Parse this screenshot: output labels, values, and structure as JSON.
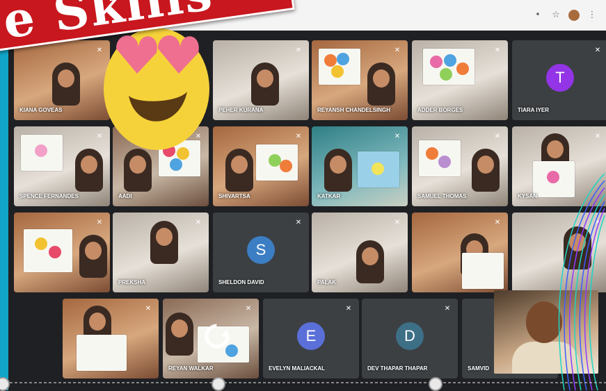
{
  "banner": {
    "text": "e Skills"
  },
  "browser": {
    "icons": [
      "more-icon",
      "star-icon",
      "profile-avatar",
      "menu-icon"
    ]
  },
  "participants": [
    {
      "name": "KIANA GOVEAS",
      "kind": "camera"
    },
    {
      "name": "PEHER KURANA",
      "kind": "camera"
    },
    {
      "name": "REYANSH CHANDELSINGH",
      "kind": "camera"
    },
    {
      "name": "ADDER BORGES",
      "kind": "camera"
    },
    {
      "name": "TIARA IYER",
      "kind": "avatar",
      "initial": "T",
      "color": "#9334e6"
    },
    {
      "name": "SPENCE FERNANDES",
      "kind": "camera"
    },
    {
      "name": "AADI",
      "kind": "camera"
    },
    {
      "name": "SHIVARTSA",
      "kind": "camera"
    },
    {
      "name": "KATKAR",
      "kind": "camera"
    },
    {
      "name": "SAMUEL THOMAS",
      "kind": "camera"
    },
    {
      "name": "KYSAN",
      "kind": "camera"
    },
    {
      "name": "",
      "kind": "camera"
    },
    {
      "name": "PREKSHA",
      "kind": "camera"
    },
    {
      "name": "SHELDON DAVID",
      "kind": "avatar",
      "initial": "S",
      "color": "#3c7ec4"
    },
    {
      "name": "PALAK",
      "kind": "camera"
    },
    {
      "name": "",
      "kind": "camera"
    },
    {
      "name": "",
      "kind": "camera"
    },
    {
      "name": "",
      "kind": "camera"
    },
    {
      "name": "REYAN WALKAR",
      "kind": "camera"
    },
    {
      "name": "EVELYN MALIACKAL",
      "kind": "avatar",
      "initial": "E",
      "color": "#5a6fd8"
    },
    {
      "name": "DEV THAPAR THAPAR",
      "kind": "avatar",
      "initial": "D",
      "color": "#3d6f86"
    },
    {
      "name": "SAMVID",
      "kind": "camera"
    }
  ],
  "colors": {
    "accent_strip": "#12a5c9",
    "banner": "#c8171e",
    "tile": "#3c4043"
  }
}
